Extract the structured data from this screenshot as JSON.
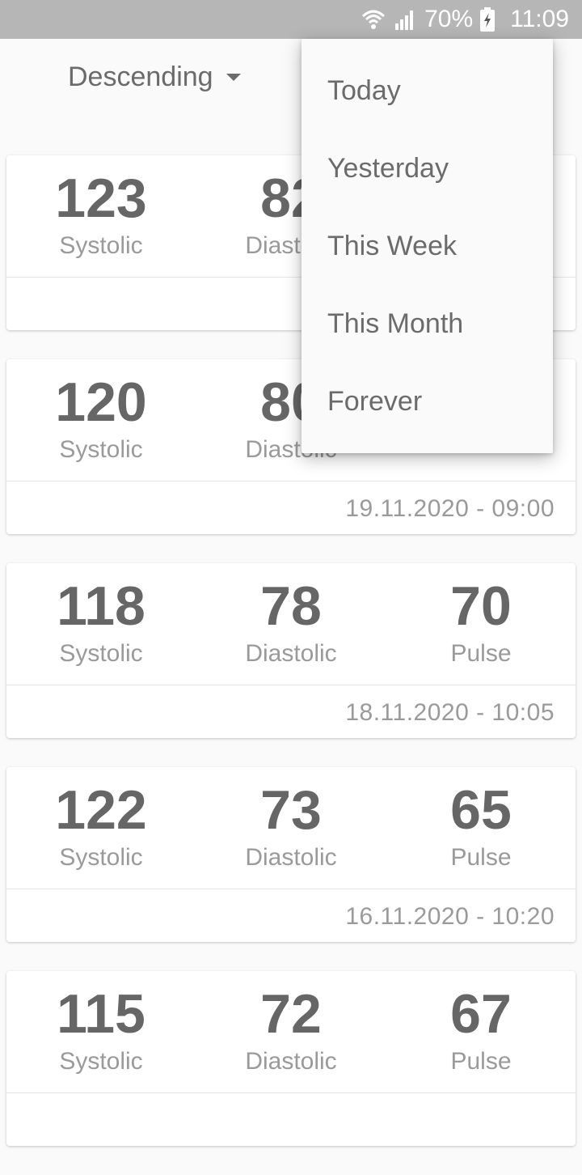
{
  "status_bar": {
    "battery_percent": "70%",
    "time": "11:09",
    "icons": [
      "wifi-icon",
      "signal-icon",
      "battery-charging-icon"
    ]
  },
  "toolbar": {
    "sort_label": "Descending"
  },
  "filter_menu": {
    "items": [
      "Today",
      "Yesterday",
      "This Week",
      "This Month",
      "Forever"
    ]
  },
  "labels": {
    "systolic": "Systolic",
    "diastolic": "Diastolic",
    "pulse": "Pulse"
  },
  "readings": [
    {
      "systolic": "123",
      "diastolic": "82",
      "pulse": "",
      "date": ""
    },
    {
      "systolic": "120",
      "diastolic": "80",
      "pulse": "",
      "date": "19.11.2020 - 09:00"
    },
    {
      "systolic": "118",
      "diastolic": "78",
      "pulse": "70",
      "date": "18.11.2020 - 10:05"
    },
    {
      "systolic": "122",
      "diastolic": "73",
      "pulse": "65",
      "date": "16.11.2020 - 10:20"
    },
    {
      "systolic": "115",
      "diastolic": "72",
      "pulse": "67",
      "date": ""
    }
  ]
}
